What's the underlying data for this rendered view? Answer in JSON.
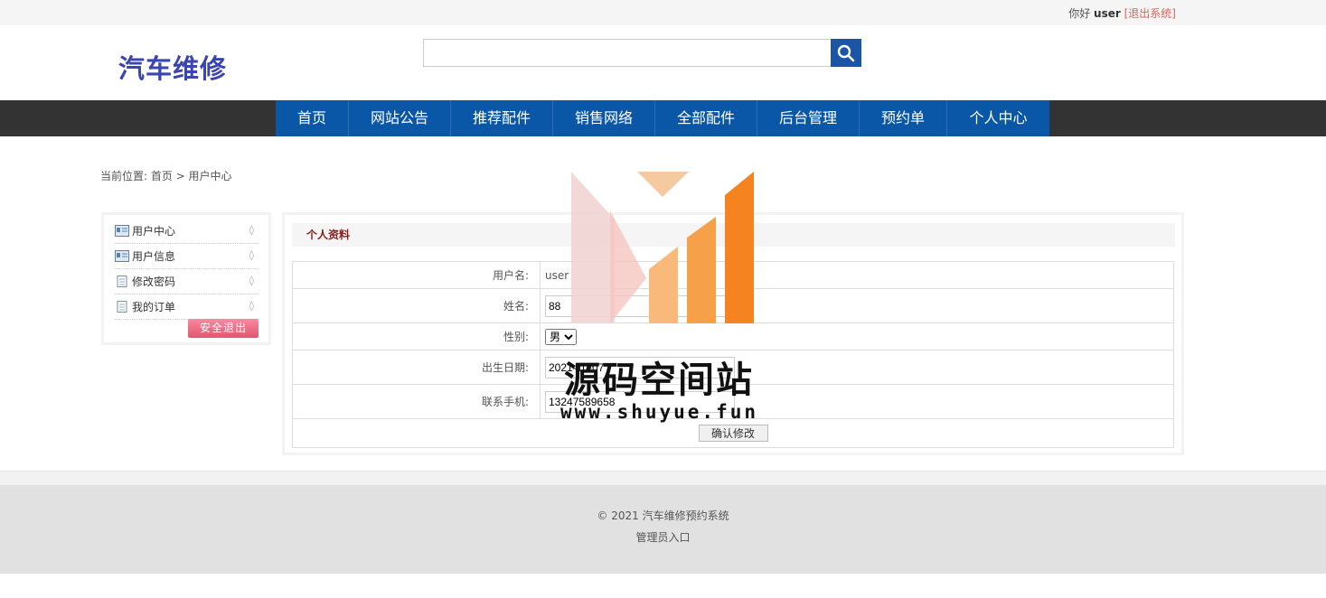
{
  "topbar": {
    "greeting": "你好",
    "username": "user",
    "logout": "[退出系统]"
  },
  "header": {
    "logo": "汽车维修",
    "search_placeholder": "",
    "search_icon": "search-icon"
  },
  "nav": {
    "items": [
      "首页",
      "网站公告",
      "推荐配件",
      "销售网络",
      "全部配件",
      "后台管理",
      "预约单",
      "个人中心"
    ]
  },
  "breadcrumb": {
    "text": "当前位置: 首页 > 用户中心"
  },
  "sidebar": {
    "items": [
      {
        "label": "用户中心",
        "icon": "id-card-icon"
      },
      {
        "label": "用户信息",
        "icon": "id-card-icon"
      },
      {
        "label": "修改密码",
        "icon": "document-icon"
      },
      {
        "label": "我的订单",
        "icon": "document-icon"
      }
    ],
    "exit_label": "安全退出"
  },
  "form": {
    "title": "个人资料",
    "username_label": "用户名:",
    "username_value": "user",
    "name_label": "姓名:",
    "name_value": "88",
    "gender_label": "性别:",
    "gender_value": "男",
    "birthday_label": "出生日期:",
    "birthday_value": "2021-10-07",
    "phone_label": "联系手机:",
    "phone_value": "13247589658",
    "submit_label": "确认修改"
  },
  "footer": {
    "copyright": "© 2021 汽车维修预约系统",
    "admin_link": "管理员入口"
  },
  "watermark": {
    "title": "源码空间站",
    "url": "www.shuyue.fun"
  },
  "colors": {
    "nav_blue": "#0a57a8",
    "logo": "#3a45b0",
    "title_red": "#8b1a1a",
    "orange": "#f5831f"
  }
}
